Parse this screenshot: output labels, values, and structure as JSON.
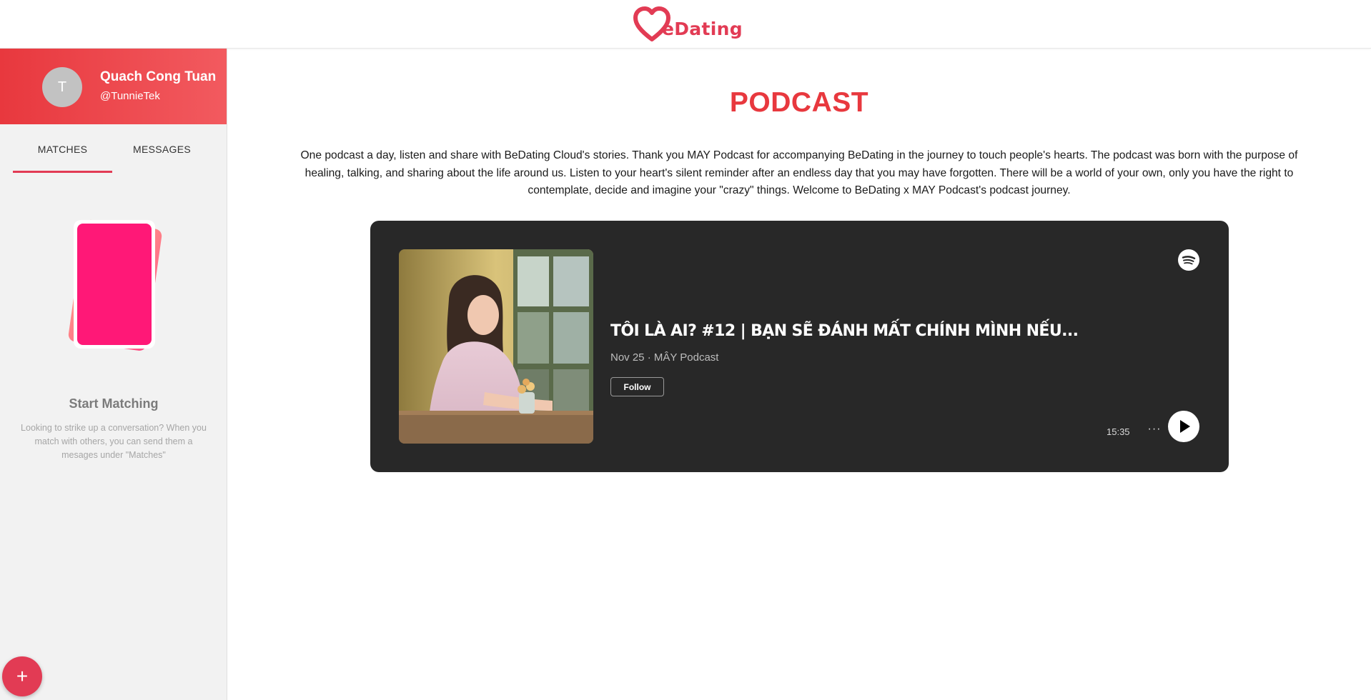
{
  "brand": {
    "name": "eDating",
    "color": "#e23b54",
    "logo_icon": "heart-icon"
  },
  "sidebar": {
    "profile": {
      "avatar_initial": "T",
      "name": "Quach Cong Tuan",
      "handle": "@TunnieTek"
    },
    "tabs": [
      {
        "label": "MATCHES",
        "active": true
      },
      {
        "label": "MESSAGES",
        "active": false
      }
    ],
    "empty_state": {
      "illustration": "cards-icon",
      "title": "Start Matching",
      "description": "Looking to strike up a conversation? When you match with others, you can send them a mesages under \"Matches\""
    },
    "fab_label": "+"
  },
  "main": {
    "title": "PODCAST",
    "description": "One podcast a day, listen and share with BeDating Cloud's stories. Thank you MAY Podcast for accompanying BeDating in the journey to touch people's hearts. The podcast was born with the purpose of healing, talking, and sharing about the life around us. Listen to your heart's silent reminder after an endless day that you may have forgotten. There will be a world of your own, only you have the right to contemplate, decide and imagine your \"crazy\" things. Welcome to BeDating x MAY Podcast's podcast journey."
  },
  "embed": {
    "provider_icon": "spotify-icon",
    "episode_title": "TÔI LÀ AI? #12 | BẠN SẼ ĐÁNH MẤT CHÍNH MÌNH NẾU...",
    "meta": "Nov 25 · MÂY Podcast",
    "follow_label": "Follow",
    "duration": "15:35",
    "more_label": "···",
    "play_icon": "play-icon",
    "background": "#282828"
  },
  "colors": {
    "accent": "#e23b54",
    "title_red": "#e8383e",
    "card_pink": "#ff1877"
  }
}
